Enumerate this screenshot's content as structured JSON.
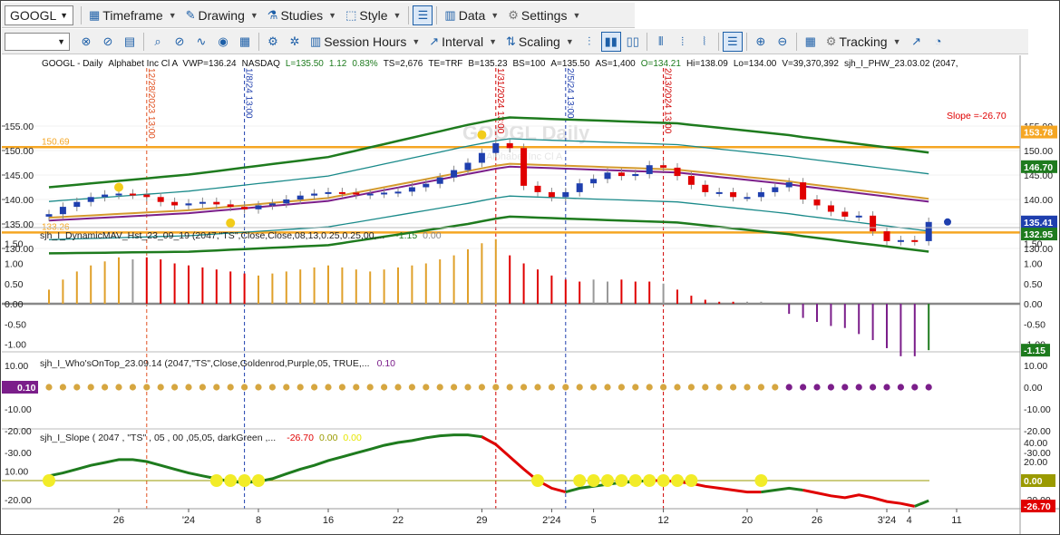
{
  "toolbar1": {
    "symbol": "GOOGL",
    "items": [
      {
        "label": "Timeframe",
        "icon": "calendar-icon"
      },
      {
        "label": "Drawing",
        "icon": "pencil-icon"
      },
      {
        "label": "Studies",
        "icon": "flask-icon"
      },
      {
        "label": "Style",
        "icon": "style-icon"
      },
      {
        "label": "Data",
        "icon": "data-icon"
      },
      {
        "label": "Settings",
        "icon": "gear-icon"
      }
    ]
  },
  "toolbar2": {
    "session_hours": "Session Hours",
    "interval": "Interval",
    "scaling": "Scaling",
    "tracking": "Tracking"
  },
  "price_pane": {
    "header": [
      "GOOGL - Daily",
      "Alphabet Inc Cl A",
      "VWP=136.24",
      "NASDAQ",
      "L=135.50",
      "1.12",
      "0.83%",
      "TS=2,676",
      "TE=TRF",
      "B=135.23",
      "BS=100",
      "A=135.50",
      "AS=1,400",
      "O=134.21",
      "Hi=138.09",
      "Lo=134.00",
      "V=39,370,392",
      "sjh_I_PHW_23.03.02 (2047,"
    ],
    "watermark": "GOOGL Daily",
    "watermark_sub": "Alphabet Inc Cl A",
    "level_labels": [
      "150.69",
      "133.26"
    ],
    "slope_label": "Slope =-26.70",
    "y_ticks": [
      "155.00",
      "150.00",
      "145.00",
      "140.00",
      "135.00",
      "130.00"
    ],
    "right_tags": [
      {
        "text": "153.78",
        "color": "#f5a623"
      },
      {
        "text": "146.70",
        "color": "#1e7b1e"
      },
      {
        "text": "135.41",
        "color": "#1f3fae"
      },
      {
        "text": "132.95",
        "color": "#1e7b1e"
      }
    ],
    "vline_labels": [
      "12/28/2023 13:00",
      "1/8/24 13:00",
      "1/31/2024 13:00",
      "2/5/24 13:00",
      "2/13/2024 13:00"
    ]
  },
  "hist_pane": {
    "title": "sjh_I_DynamicMAV_Hst_23_09_19 (2047,\"TS\",Close,Close,08,13,0.25,0.25,00,...",
    "v1": "-1.15",
    "v2": "0.00",
    "y_ticks": [
      "1.50",
      "1.00",
      "0.50",
      "0.00",
      "-0.50",
      "-1.00"
    ],
    "tag": "-1.15",
    "values": [
      0.35,
      0.6,
      0.8,
      0.95,
      1.05,
      1.15,
      1.1,
      1.15,
      1.1,
      1.0,
      0.95,
      0.9,
      0.85,
      0.8,
      0.75,
      0.7,
      0.75,
      0.8,
      0.85,
      0.9,
      0.95,
      0.9,
      0.85,
      0.8,
      0.85,
      0.9,
      0.95,
      1.0,
      1.1,
      1.2,
      1.35,
      1.5,
      1.6,
      1.2,
      1.0,
      0.85,
      0.7,
      0.6,
      0.55,
      0.6,
      0.55,
      0.6,
      0.55,
      0.55,
      0.5,
      0.35,
      0.2,
      0.1,
      0.05,
      0.05,
      0.05,
      0.05,
      0.0,
      -0.25,
      -0.35,
      -0.45,
      -0.55,
      -0.6,
      -0.75,
      -0.9,
      -1.1,
      -1.3,
      -1.3,
      -1.15
    ],
    "colors": [
      "g",
      "g",
      "g",
      "g",
      "g",
      "g",
      "x",
      "r",
      "r",
      "r",
      "r",
      "r",
      "r",
      "r",
      "r",
      "g",
      "g",
      "g",
      "g",
      "g",
      "g",
      "g",
      "g",
      "g",
      "g",
      "g",
      "g",
      "g",
      "g",
      "g",
      "g",
      "g",
      "g",
      "r",
      "r",
      "r",
      "r",
      "r",
      "r",
      "x",
      "x",
      "r",
      "r",
      "r",
      "x",
      "r",
      "r",
      "r",
      "r",
      "r",
      "x",
      "x",
      "x",
      "p",
      "p",
      "p",
      "p",
      "p",
      "p",
      "p",
      "p",
      "p",
      "p",
      "k"
    ]
  },
  "wot_pane": {
    "title": "sjh_I_Who'sOnTop_23.09.14 (2047,\"TS\",Close,Goldenrod,Purple,05,  TRUE,...",
    "v1": "0.10",
    "y_ticks": [
      "10.00",
      "0.00",
      "-10.00",
      "-20.00",
      "-30.00"
    ],
    "tag": "0.10"
  },
  "slope_pane": {
    "title": "sjh_I_Slope ( 2047 , \"TS\" , 05 , 00 ,05,05, darkGreen ,...",
    "v1": "-26.70",
    "v2": "0.00",
    "v3": "0.00",
    "y_ticks": [
      "40.00",
      "20.00",
      "10.00",
      "0.00",
      "-10.00",
      "-20.00"
    ],
    "tags": [
      {
        "text": "0.00",
        "color": "#9a9a00"
      },
      {
        "text": "-26.70",
        "color": "#e00000"
      }
    ]
  },
  "x_axis": {
    "labels": [
      "26",
      "'24",
      "8",
      "16",
      "22",
      "29",
      "2'24",
      "5",
      "12",
      "20",
      "26",
      "3'24",
      "4",
      "11"
    ]
  },
  "colors": {
    "gold": "#f5a623",
    "darkgreen": "#1e7b1e",
    "teal": "#1a8a8a",
    "purple": "#7b1e8a",
    "bar_gold": "#e0a02a",
    "bar_red": "#e00000",
    "bar_gray": "#999999",
    "bar_purple": "#7b1e8a"
  }
}
